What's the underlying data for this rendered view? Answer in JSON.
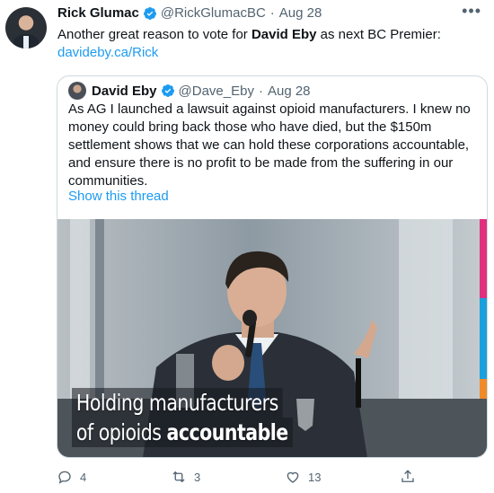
{
  "tweet": {
    "author_name": "Rick Glumac",
    "handle": "@RickGlumacBC",
    "separator": "·",
    "date": "Aug 28",
    "text_before": "Another great reason to vote for ",
    "text_bold": "David Eby",
    "text_after": " as next BC Premier:",
    "link": "davideby.ca/Rick",
    "more_icon": "more-dots-icon"
  },
  "quote": {
    "author_name": "David Eby",
    "handle": "@Dave_Eby",
    "separator": "·",
    "date": "Aug 28",
    "text": "As AG I launched a lawsuit against opioid manufacturers. I knew no money could bring back those who have died, but the $150m settlement shows that we can hold these corporations accountable, and ensure there is no profit to be made from the suffering in our communities.",
    "show_thread": "Show this thread",
    "image_caption_line1": "Holding manufacturers",
    "image_caption_line2_normal": "of opioids ",
    "image_caption_line2_bold": "accountable"
  },
  "actions": {
    "reply_count": "4",
    "retweet_count": "3",
    "like_count": "13",
    "share_label": ""
  },
  "colors": {
    "link": "#1d9bf0",
    "muted": "#536471",
    "verified": "#1d9bf0"
  }
}
